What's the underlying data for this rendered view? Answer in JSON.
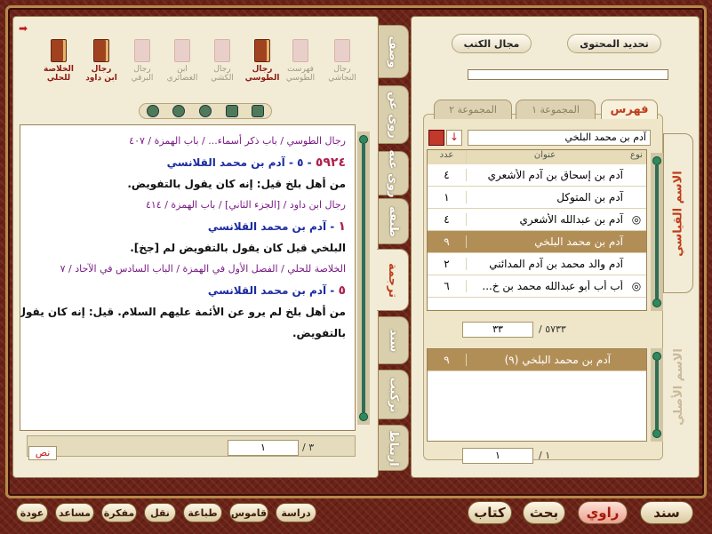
{
  "left_panel": {
    "books": [
      {
        "label": "رجال النجاشي",
        "active": false
      },
      {
        "label": "فهرست الطوسي",
        "active": false
      },
      {
        "label": "رجال الطوسي",
        "active": true
      },
      {
        "label": "رجال الكشي",
        "active": false
      },
      {
        "label": "ابن الغضائري",
        "active": false
      },
      {
        "label": "رجال البرقي",
        "active": false
      },
      {
        "label": "رجال ابن داود",
        "active": true
      },
      {
        "label": "الخلاصة للحلي",
        "active": true
      }
    ],
    "lines": [
      {
        "type": "src",
        "text": "رجال الطوسي / باب ذكر أسماء... / باب الهمزة / ٤٠٧"
      },
      {
        "type": "hd",
        "num": "٥٩٢٤",
        "text": "- ٥ - آدم بن محمد القلانسي"
      },
      {
        "type": "bd",
        "text": "من أهل بلخ قيل: إنه كان يقول بالتفويض."
      },
      {
        "type": "src",
        "text": "رجال ابن داود / [الجزء الثاني] / باب الهمزة / ٤١٤"
      },
      {
        "type": "hd",
        "num": "١",
        "text": "- آدم بن محمد القلانسي"
      },
      {
        "type": "bd",
        "text": "البلخي قيل كان يقول بالتفويض لم [جخ]."
      },
      {
        "type": "src",
        "text": "الخلاصة للحلي / الفصل الأول في الهمزة / الباب السادس في الآحاد / ٧"
      },
      {
        "type": "hd",
        "num": "٥",
        "text": "- آدم بن محمد القلانسي"
      },
      {
        "type": "bd",
        "text": "من أهل بلخ لم يرو عن الأئمة عليهم السلام. قيل: إنه كان يقول"
      },
      {
        "type": "bd",
        "text": "بالتفويض."
      }
    ],
    "page_current": "١",
    "page_total": "/ ٣",
    "text_label": "نص"
  },
  "vtabs": [
    "وصف",
    "روى عن",
    "روى عنه",
    "طبقة",
    "ترجمة",
    "سند",
    "تركيب",
    "ارتباط"
  ],
  "vtab_active": "ترجمة",
  "right_panel": {
    "btn_content": "تحديد المحتوى",
    "btn_books": "مجال الكتب",
    "tabs": [
      "فهرس",
      "المجموعة ١",
      "المجموعة ٢"
    ],
    "search_value": "آدم بن محمد البلخي",
    "headers": {
      "type": "نوع",
      "title": "عنوان",
      "count": "عدد"
    },
    "rows": [
      {
        "title": "آدم بن إسحاق بن آدم الأشعري",
        "count": "٤",
        "mark": ""
      },
      {
        "title": "آدم بن المتوكل",
        "count": "١",
        "mark": ""
      },
      {
        "title": "آدم بن عبدالله الأشعري",
        "count": "٤",
        "mark": "◎"
      },
      {
        "title": "آدم بن محمد البلخي",
        "count": "٩",
        "mark": "",
        "selected": true
      },
      {
        "title": "آدم والد محمد بن آدم المدائني",
        "count": "٢",
        "mark": ""
      },
      {
        "title": "أب أب أبو عبدالله محمد بن خ...",
        "count": "٦",
        "mark": "◎"
      }
    ],
    "page_current": "٣٣",
    "page_total": "/ ٥٧٣٣",
    "result_rows": [
      {
        "title": "آدم بن محمد البلخي (٩)",
        "count": "٩"
      }
    ],
    "result_current": "١",
    "result_total": "/ ١",
    "side_tab1": "الاسم القياسي",
    "side_tab2": "الاسم الأصلي"
  },
  "bottom_left": [
    "عودة",
    "مساعد",
    "مفكرة",
    "نقل",
    "طباعة",
    "قاموس",
    "دراسة"
  ],
  "bottom_right": [
    "سند",
    "راوي",
    "بحث",
    "كتاب"
  ]
}
